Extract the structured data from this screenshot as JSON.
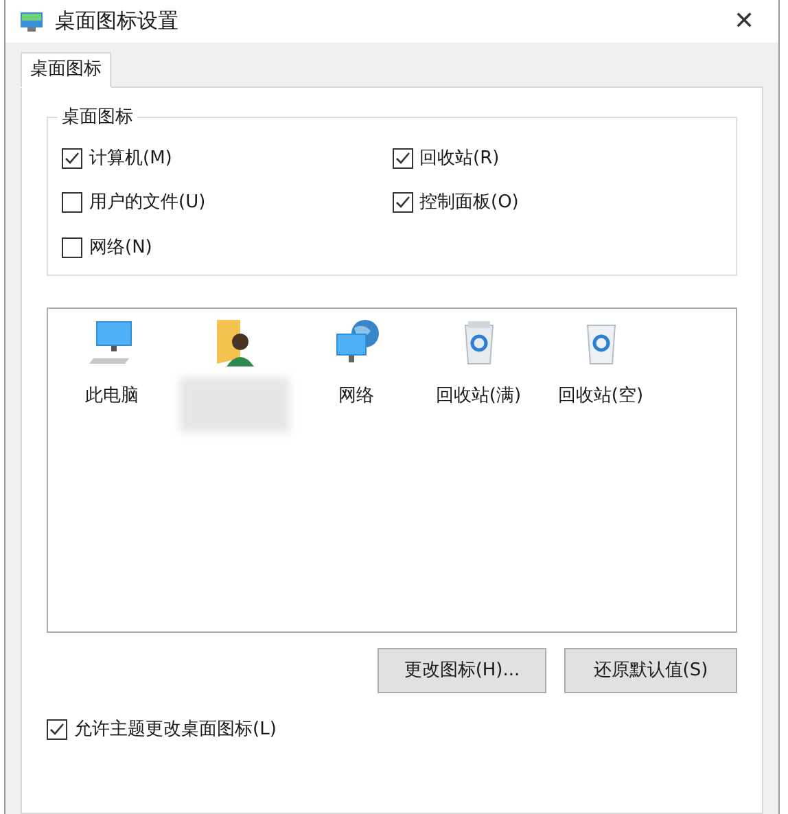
{
  "window": {
    "title": "桌面图标设置",
    "close": "✕"
  },
  "tabs": [
    {
      "label": "桌面图标",
      "selected": true
    }
  ],
  "group": {
    "title": "桌面图标",
    "checkboxes": [
      {
        "label": "计算机(M)",
        "checked": true
      },
      {
        "label": "回收站(R)",
        "checked": true
      },
      {
        "label": "用户的文件(U)",
        "checked": false
      },
      {
        "label": "控制面板(O)",
        "checked": true
      },
      {
        "label": "网络(N)",
        "checked": false
      }
    ]
  },
  "icons": [
    {
      "kind": "computer",
      "label": "此电脑"
    },
    {
      "kind": "user"
    },
    {
      "kind": "network",
      "label": "网络"
    },
    {
      "kind": "recycle-full",
      "label": "回收站(满)"
    },
    {
      "kind": "recycle-empty",
      "label": "回收站(空)"
    }
  ],
  "buttons": [
    "更改图标(H)...",
    "还原默认值(S)"
  ],
  "allow_themes": {
    "label": "允许主题更改桌面图标(L)",
    "checked": true
  }
}
